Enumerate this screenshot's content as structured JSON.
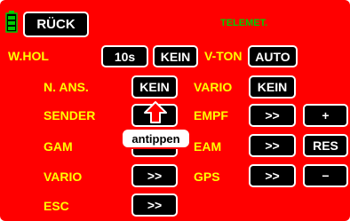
{
  "header": {
    "back_label": "RÜCK",
    "title": "TELEMET."
  },
  "row_whol": {
    "label": "W.HOL",
    "time_value": "10s",
    "whol_switch": "KEIN",
    "vton_label": "V-TON",
    "vton_value": "AUTO"
  },
  "row_nans": {
    "label": "N. ANS.",
    "value": "KEIN",
    "vario_label": "VARIO",
    "vario_value": "KEIN"
  },
  "rows": [
    {
      "left_label": "SENDER",
      "left_button": "",
      "right_label": "EMPF",
      "right_button": ">>",
      "extra_button": "+"
    },
    {
      "left_label": "GAM",
      "left_button": "",
      "right_label": "EAM",
      "right_button": ">>",
      "extra_button": "RES"
    },
    {
      "left_label": "VARIO",
      "left_button": ">>",
      "right_label": "GPS",
      "right_button": ">>",
      "extra_button": "−"
    },
    {
      "left_label": "ESC",
      "left_button": ">>"
    }
  ],
  "callout": {
    "text": "antippen"
  },
  "colors": {
    "background": "#ff0000",
    "label": "#ffff00",
    "title": "#00cc00",
    "button": "#000000",
    "battery": "#00cc00"
  },
  "icons": {
    "battery": "battery-icon",
    "arrow": "up-arrow-icon"
  }
}
